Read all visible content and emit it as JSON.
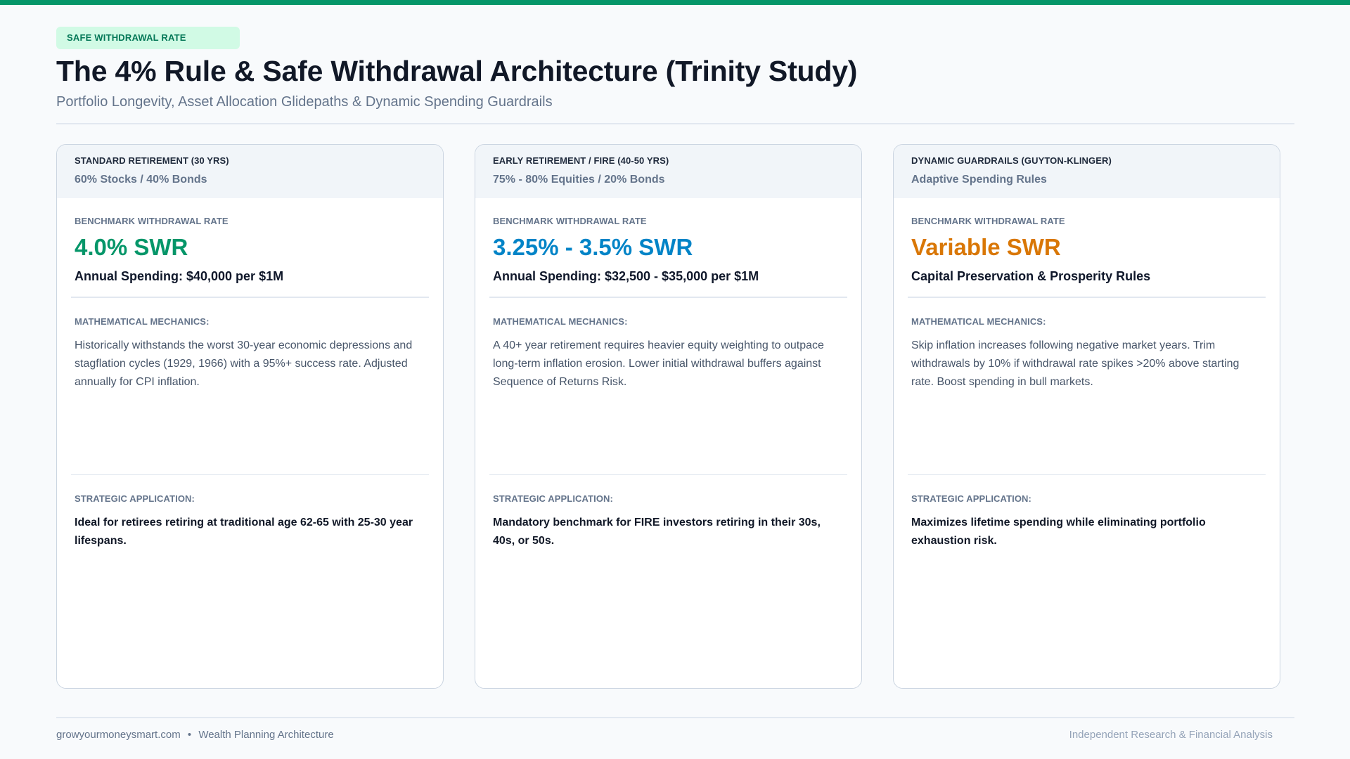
{
  "badge": "SAFE WITHDRAWAL RATE",
  "title": "The 4% Rule & Safe Withdrawal Architecture (Trinity Study)",
  "subtitle": "Portfolio Longevity, Asset Allocation Glidepaths & Dynamic Spending Guardrails",
  "colors": {
    "accent": "#059669",
    "green": "#059669",
    "blue": "#0284c7",
    "orange": "#d97706"
  },
  "cards": [
    {
      "header": "STANDARD RETIREMENT (30 YRS)",
      "allocation": "60% Stocks / 40% Bonds",
      "benchmark_label": "BENCHMARK WITHDRAWAL RATE",
      "swr": "4.0% SWR",
      "spending": "Annual Spending: $40,000 per $1M",
      "mechanics_label": "MATHEMATICAL MECHANICS:",
      "mechanics": "Historically withstands the worst 30-year economic depressions and stagflation cycles (1929, 1966) with a 95%+ success rate. Adjusted annually for CPI inflation.",
      "application_label": "STRATEGIC APPLICATION:",
      "application": "Ideal for retirees retiring at traditional age 62-65 with 25-30 year lifespans."
    },
    {
      "header": "EARLY RETIREMENT / FIRE (40-50 YRS)",
      "allocation": "75% - 80% Equities / 20% Bonds",
      "benchmark_label": "BENCHMARK WITHDRAWAL RATE",
      "swr": "3.25% - 3.5% SWR",
      "spending": "Annual Spending: $32,500 - $35,000 per $1M",
      "mechanics_label": "MATHEMATICAL MECHANICS:",
      "mechanics": "A 40+ year retirement requires heavier equity weighting to outpace long-term inflation erosion. Lower initial withdrawal buffers against Sequence of Returns Risk.",
      "application_label": "STRATEGIC APPLICATION:",
      "application": "Mandatory benchmark for FIRE investors retiring in their 30s, 40s, or 50s."
    },
    {
      "header": "DYNAMIC GUARDRAILS (GUYTON-KLINGER)",
      "allocation": "Adaptive Spending Rules",
      "benchmark_label": "BENCHMARK WITHDRAWAL RATE",
      "swr": "Variable SWR",
      "spending": "Capital Preservation & Prosperity Rules",
      "mechanics_label": "MATHEMATICAL MECHANICS:",
      "mechanics": "Skip inflation increases following negative market years. Trim withdrawals by 10% if withdrawal rate spikes >20% above starting rate. Boost spending in bull markets.",
      "application_label": "STRATEGIC APPLICATION:",
      "application": "Maximizes lifetime spending while eliminating portfolio exhaustion risk."
    }
  ],
  "footer": {
    "site": "growyourmoneysmart.com",
    "separator": "•",
    "section": "Wealth Planning Architecture",
    "right": "Independent Research & Financial Analysis"
  }
}
